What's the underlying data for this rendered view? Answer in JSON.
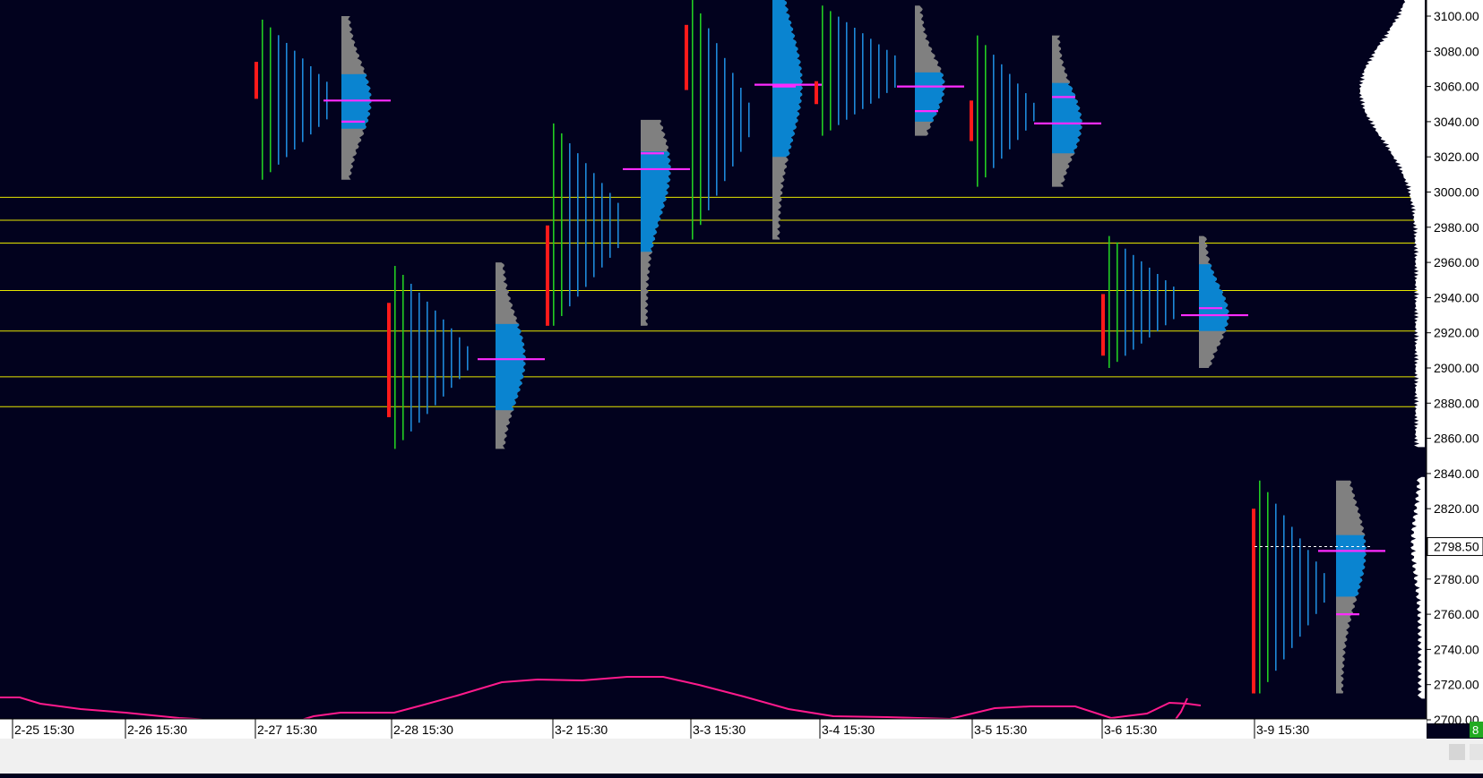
{
  "chart_data": {
    "type": "market-profile",
    "instrument_price_axis": {
      "ylim": [
        2700,
        3110
      ],
      "ticks": [
        "3100.00",
        "3080.00",
        "3060.00",
        "3040.00",
        "3020.00",
        "3000.00",
        "2980.00",
        "2960.00",
        "2940.00",
        "2920.00",
        "2900.00",
        "2880.00",
        "2860.00",
        "2840.00",
        "2820.00",
        "2800.00",
        "2780.00",
        "2760.00",
        "2740.00",
        "2720.00",
        "2700.00"
      ],
      "last_price": "2798.50",
      "corner_badge": "8"
    },
    "time_axis": {
      "labels": [
        "2-25  15:30",
        "2-26  15:30",
        "2-27  15:30",
        "2-28  15:30",
        "3-2  15:30",
        "3-3  15:30",
        "3-4  15:30",
        "3-5  15:30",
        "3-6  15:30",
        "3-9  15:30"
      ]
    },
    "horizontal_levels": [
      2997,
      2984,
      2971,
      2944,
      2921,
      2895,
      2878
    ],
    "sessions": [
      {
        "label": "2-27",
        "tpo_low": 3007,
        "tpo_high": 3098,
        "profile_low": 3007,
        "profile_high": 3100,
        "poc": 3052,
        "va_low": 3036,
        "va_high": 3067,
        "red_low": 3053,
        "red_high": 3074,
        "secondary_poc": 3040
      },
      {
        "label": "2-28",
        "tpo_low": 2854,
        "tpo_high": 2958,
        "profile_low": 2854,
        "profile_high": 2960,
        "poc": 2905,
        "va_low": 2876,
        "va_high": 2925,
        "red_low": 2872,
        "red_high": 2937,
        "secondary_poc": null
      },
      {
        "label": "3-2",
        "tpo_low": 2924,
        "tpo_high": 3039,
        "profile_low": 2924,
        "profile_high": 3041,
        "poc": 3013,
        "va_low": 2966,
        "va_high": 3023,
        "red_low": 2924,
        "red_high": 2981,
        "secondary_poc": 3022
      },
      {
        "label": "3-3",
        "tpo_low": 2973,
        "tpo_high": 3110,
        "profile_low": 2973,
        "profile_high": 3110,
        "poc": 3061,
        "va_low": 3020,
        "va_high": 3110,
        "red_low": 3058,
        "red_high": 3095,
        "secondary_poc": 3060
      },
      {
        "label": "3-4",
        "tpo_low": 3032,
        "tpo_high": 3106,
        "profile_low": 3032,
        "profile_high": 3106,
        "poc": 3060,
        "va_low": 3040,
        "va_high": 3068,
        "red_low": 3050,
        "red_high": 3063,
        "secondary_poc": 3046
      },
      {
        "label": "3-5",
        "tpo_low": 3003,
        "tpo_high": 3089,
        "profile_low": 3003,
        "profile_high": 3089,
        "poc": 3039,
        "va_low": 3022,
        "va_high": 3062,
        "red_low": 3029,
        "red_high": 3052,
        "secondary_poc": 3054
      },
      {
        "label": "3-6",
        "tpo_low": 2900,
        "tpo_high": 2975,
        "profile_low": 2900,
        "profile_high": 2975,
        "poc": 2930,
        "va_low": 2921,
        "va_high": 2959,
        "red_low": 2907,
        "red_high": 2942,
        "secondary_poc": 2934
      },
      {
        "label": "3-9",
        "tpo_low": 2715,
        "tpo_high": 2836,
        "profile_low": 2715,
        "profile_high": 2836,
        "poc": 2796,
        "va_low": 2770,
        "va_high": 2805,
        "red_low": 2715,
        "red_high": 2820,
        "secondary_poc": 2760
      }
    ],
    "composite_profile": {
      "low": 2855,
      "high": 3110,
      "peak": 3058
    },
    "lower_indicator": {
      "color": "#ff1a8c"
    }
  }
}
